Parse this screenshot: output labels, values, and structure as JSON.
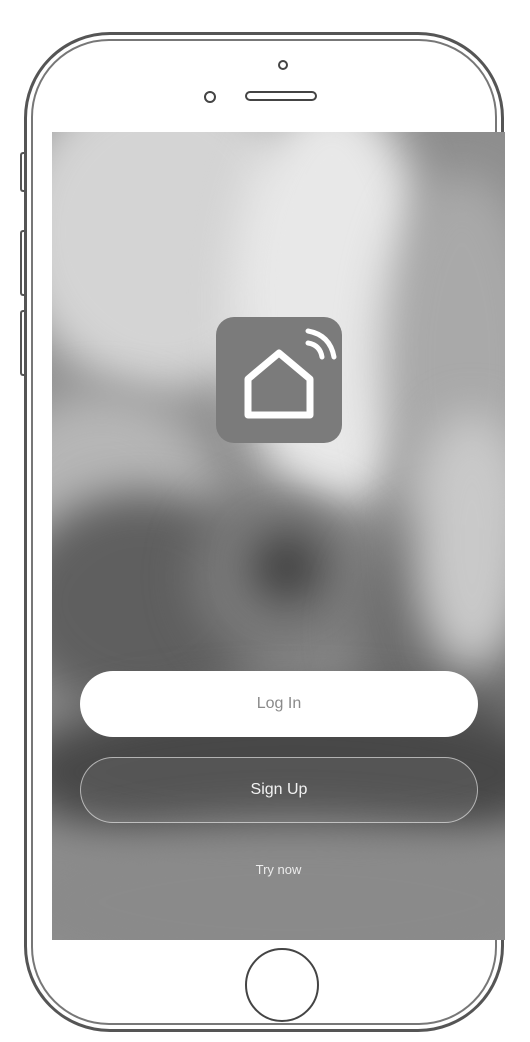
{
  "app": {
    "icon": "smart-home-icon",
    "colors": {
      "icon_tile": "#7b7b7b",
      "login_button": "#ffffff",
      "login_text": "#8a8a8a",
      "signup_text": "#f2f2f2"
    }
  },
  "actions": {
    "login_label": "Log In",
    "signup_label": "Sign Up",
    "try_now_label": "Try now"
  }
}
